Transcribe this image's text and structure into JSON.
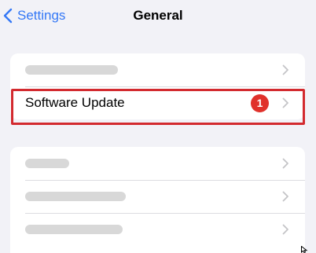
{
  "nav": {
    "back_label": "Settings",
    "title": "General"
  },
  "group1": {
    "rows": [
      {
        "label": "",
        "placeholder": true
      },
      {
        "label": "Software Update",
        "badge": "1"
      }
    ]
  },
  "group2": {
    "rows": [
      {
        "label": "",
        "placeholder": true
      },
      {
        "label": "",
        "placeholder": true
      },
      {
        "label": "",
        "placeholder": true
      }
    ]
  },
  "colors": {
    "accent": "#3478f6",
    "badge": "#e0312b",
    "highlight": "#d32a2f",
    "background": "#f2f2f7"
  },
  "icons": [
    "chevron-left-icon",
    "chevron-right-icon",
    "cursor-icon"
  ]
}
